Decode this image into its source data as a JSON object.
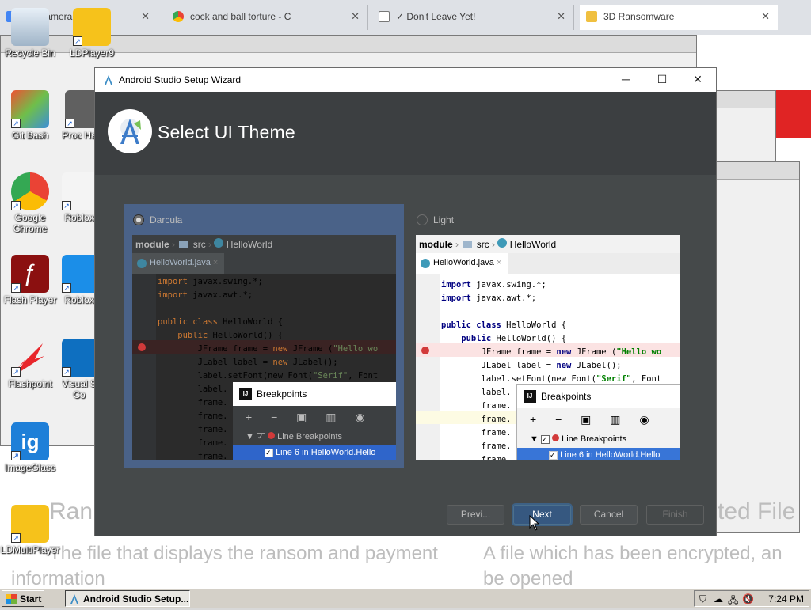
{
  "browser": {
    "tabs": [
      {
        "label": "Ne Camera"
      },
      {
        "label": "cock and ball torture - C"
      },
      {
        "label": "✓ Don't Leave Yet!"
      },
      {
        "label": "3D Ransomware"
      }
    ]
  },
  "desktop": {
    "icons": [
      {
        "label": "Recycle Bin"
      },
      {
        "label": "LDPlayer9"
      },
      {
        "label": "Git Bash"
      },
      {
        "label": "Proc Hack"
      },
      {
        "label": "Google Chrome"
      },
      {
        "label": "Roblox"
      },
      {
        "label": "Flash Player"
      },
      {
        "label": "Roblox"
      },
      {
        "label": "Flashpoint"
      },
      {
        "label": "Visual S Co"
      },
      {
        "label": "ImageGlass"
      },
      {
        "label": "LDMultiPlayer"
      }
    ]
  },
  "background_page": {
    "heading_left": "Ran",
    "heading_right": "ted File",
    "para_left_1": "The file that displays the ransom and payment",
    "para_left_2": "information",
    "para_right_1": "A file which has been encrypted, an",
    "para_right_2": "be opened"
  },
  "dialog": {
    "title": "Android Studio Setup Wizard",
    "page_title": "Select UI Theme",
    "themes": {
      "darcula": {
        "label": "Darcula",
        "selected": true
      },
      "light": {
        "label": "Light",
        "selected": false
      }
    },
    "preview": {
      "breadcrumb": {
        "module": "module",
        "src": "src",
        "file": "HelloWorld"
      },
      "tab": "HelloWorld.java",
      "code": {
        "l1_kw": "import",
        "l1_rest": " javax.swing.*;",
        "l2_kw": "import",
        "l2_rest": " javax.awt.*;",
        "l3_kw": "public class",
        "l3_rest": " HelloWorld {",
        "l4_kw": "    public",
        "l4_rest": " HelloWorld() {",
        "l5_a": "        JFrame frame = ",
        "l5_kw": "new",
        "l5_b": " JFrame (",
        "l5_str": "\"Hello wo",
        "l6_a": "        JLabel label = ",
        "l6_kw": "new",
        "l6_b": " JLabel();",
        "l7_a": "        label.setFont(new Font(",
        "l7_str": "\"Serif\"",
        "l7_b": ", Font",
        "l8": "        label.",
        "l9": "        frame.",
        "l10": "        frame.",
        "l11": "        frame.",
        "l12": "        frame.",
        "l13": "        frame."
      },
      "breakpoints": {
        "title": "Breakpoints",
        "tools": "+ − ▣ ▥ ◉",
        "group": "Line Breakpoints",
        "item": "Line 6 in HelloWorld.Hello"
      }
    },
    "buttons": {
      "previous": "Previ...",
      "next": "Next",
      "cancel": "Cancel",
      "finish": "Finish"
    }
  },
  "taskbar": {
    "start": "Start",
    "task": "Android Studio Setup...",
    "clock": "7:24 PM"
  }
}
